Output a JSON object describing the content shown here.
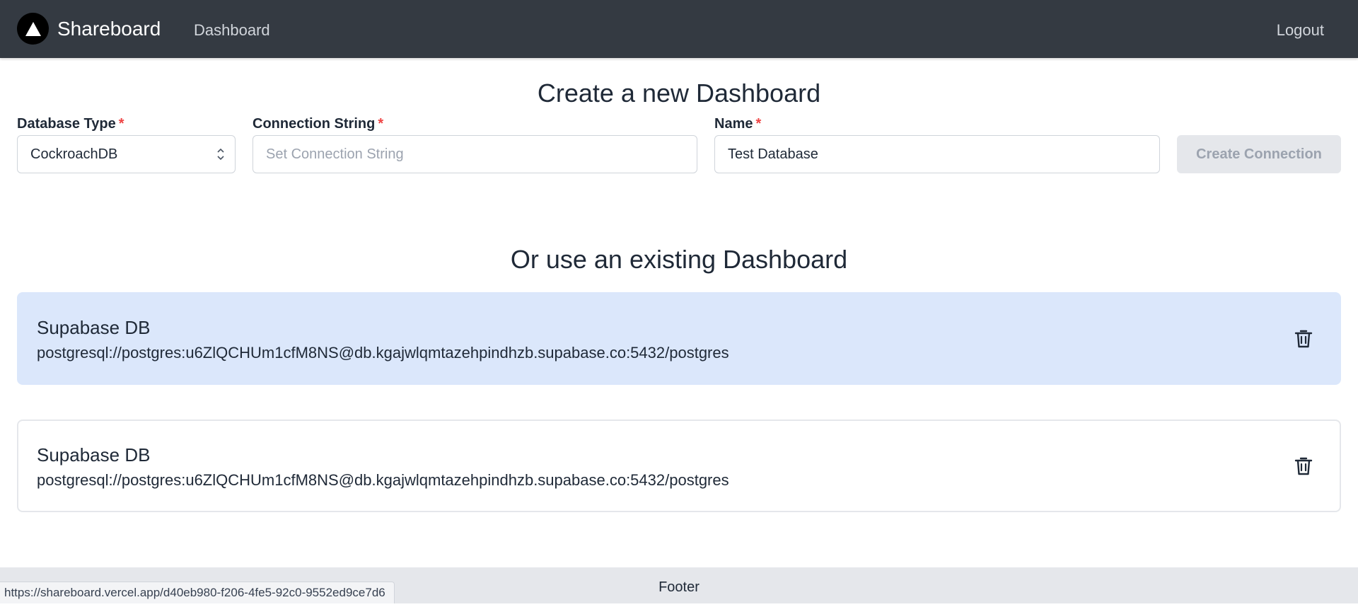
{
  "navbar": {
    "logo_icon": "triangle-logo-icon",
    "brand": "Shareboard",
    "links": [
      {
        "label": "Dashboard"
      }
    ],
    "logout_label": "Logout"
  },
  "create": {
    "title": "Create a new Dashboard",
    "database_type": {
      "label": "Database Type",
      "required_mark": "*",
      "value": "CockroachDB"
    },
    "connection_string": {
      "label": "Connection String",
      "required_mark": "*",
      "value": "",
      "placeholder": "Set Connection String"
    },
    "name": {
      "label": "Name",
      "required_mark": "*",
      "value": "Test Database"
    },
    "submit_label": "Create Connection"
  },
  "existing": {
    "title": "Or use an existing Dashboard",
    "dashboards": [
      {
        "name": "Supabase DB",
        "connection": "postgresql://postgres:u6ZlQCHUm1cfM8NS@db.kgajwlqmtazehpindhzb.supabase.co:5432/postgres",
        "highlighted": true
      },
      {
        "name": "Supabase DB",
        "connection": "postgresql://postgres:u6ZlQCHUm1cfM8NS@db.kgajwlqmtazehpindhzb.supabase.co:5432/postgres",
        "highlighted": false
      }
    ]
  },
  "footer": {
    "text": "Footer"
  },
  "status_bar": {
    "url": "https://shareboard.vercel.app/d40eb980-f206-4fe5-92c0-9552ed9ce7d6"
  },
  "colors": {
    "navbar_bg": "#343a42",
    "highlight_card": "#dbe7fb",
    "required": "#ef4444",
    "disabled_button": "#e5e7eb"
  }
}
